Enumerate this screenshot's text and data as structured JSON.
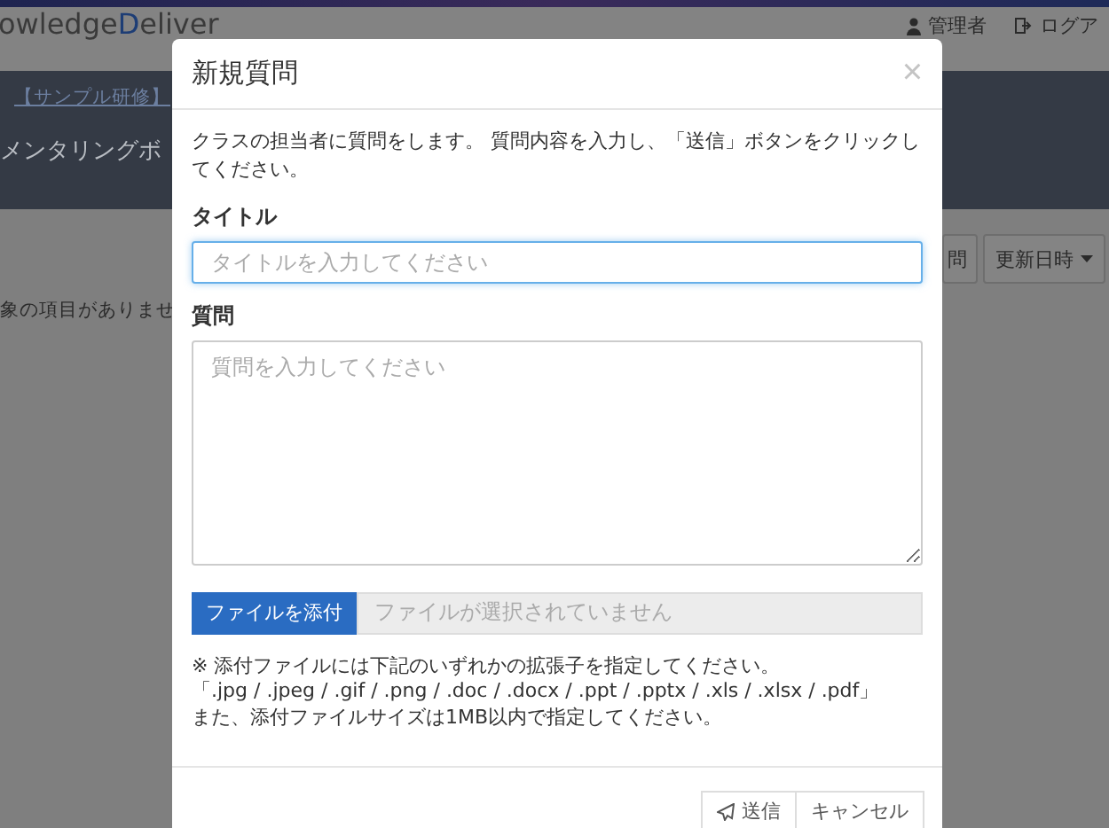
{
  "header": {
    "logo": {
      "before": "owledge",
      "accent": "D",
      "after": "eliver"
    },
    "user": "管理者",
    "logout": "ログア"
  },
  "banner": {
    "breadcrumb": "【サンプル研修】",
    "title": "メンタリングボ"
  },
  "toolbar": {
    "buttons": [
      {
        "label": "問",
        "dropdown": false
      },
      {
        "label": "更新日時",
        "dropdown": true
      }
    ]
  },
  "empty_message": "象の項目がありませ",
  "dialog": {
    "title": "新規質問",
    "close": "×",
    "description": "クラスの担当者に質問をします。 質問内容を入力し、「送信」ボタンをクリックしてください。",
    "fields": [
      {
        "label": "タイトル",
        "placeholder": "タイトルを入力してください",
        "kind": "input",
        "focused": true
      },
      {
        "label": "質問",
        "placeholder": "質問を入力してください",
        "kind": "textarea",
        "focused": false
      }
    ],
    "file": {
      "button": "ファイルを添付",
      "status": "ファイルが選択されていません"
    },
    "notes": [
      "※ 添付ファイルには下記のいずれかの拡張子を指定してください。",
      "「.jpg / .jpeg / .gif / .png / .doc / .docx / .ppt / .pptx / .xls / .xlsx / .pdf」",
      "また、添付ファイルサイズは1MB以内で指定してください。"
    ],
    "buttons": [
      {
        "label": "送信"
      },
      {
        "label": "キャンセル"
      }
    ]
  }
}
